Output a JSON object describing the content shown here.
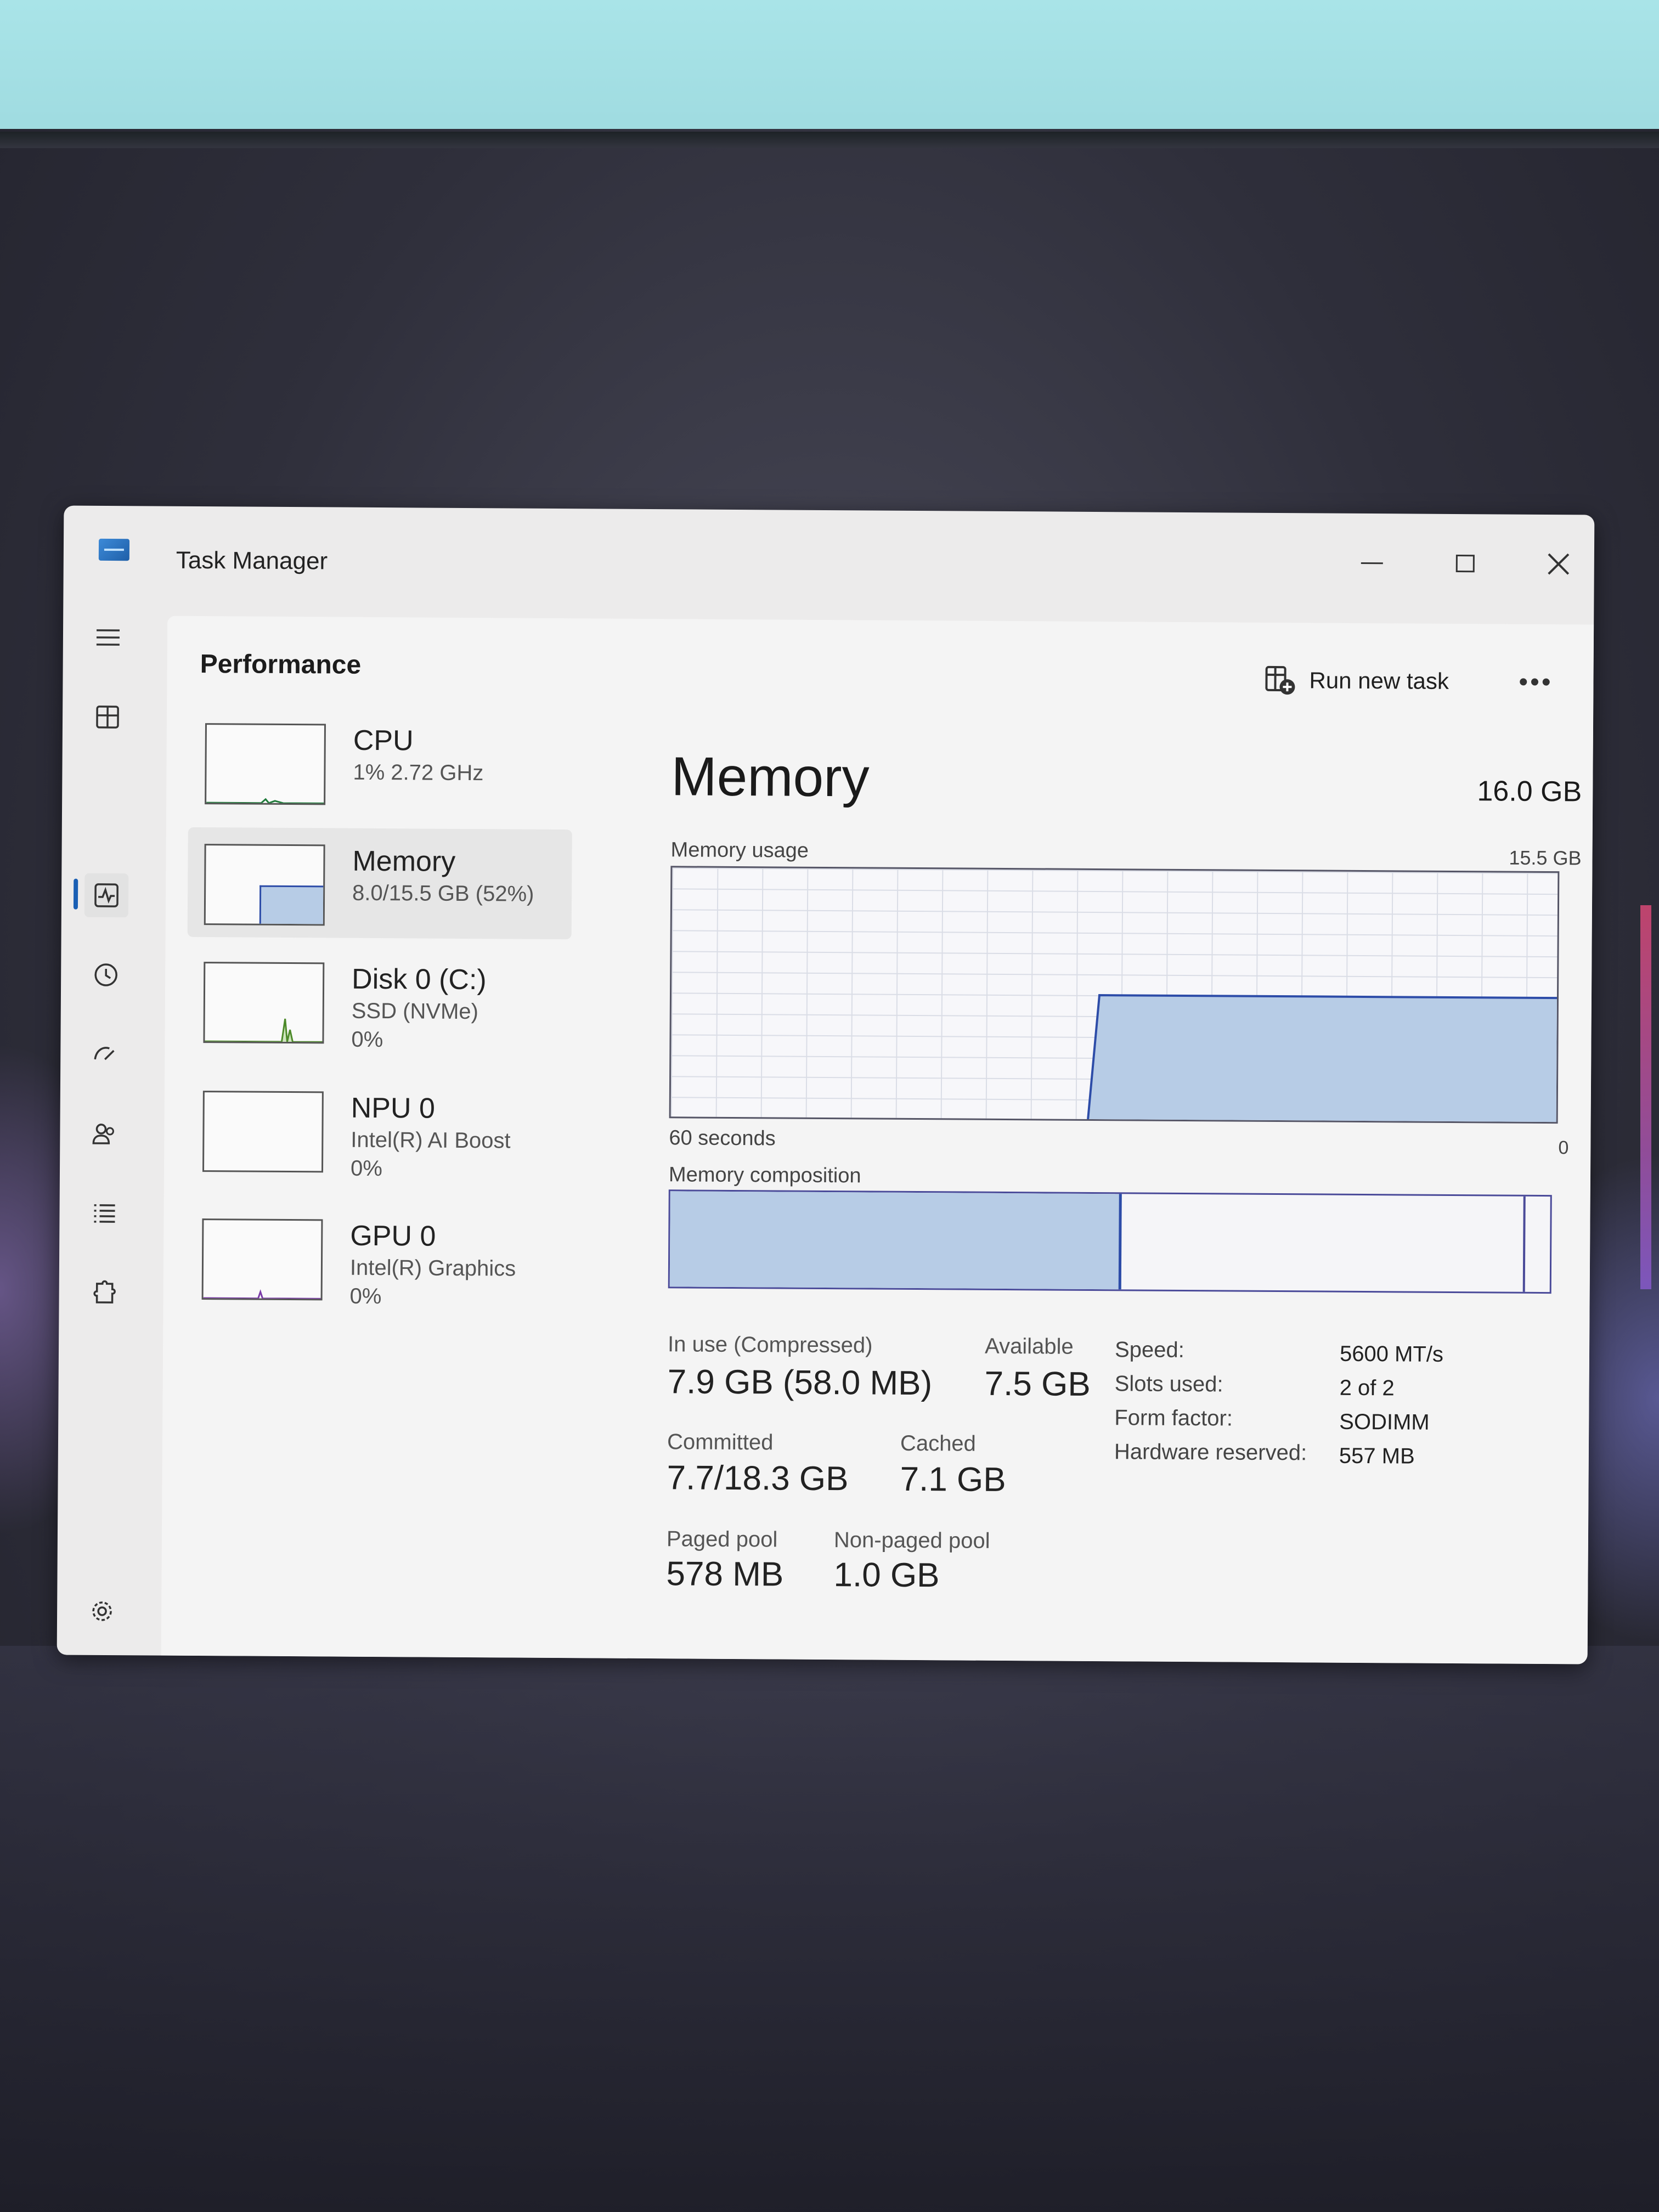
{
  "window": {
    "title": "Task Manager"
  },
  "header": {
    "title": "Performance",
    "run_new_task": "Run new task",
    "more": "•••"
  },
  "nav": {
    "items": [
      "hamburger-menu",
      "processes",
      "performance",
      "app-history",
      "startup-apps",
      "users",
      "details",
      "services",
      "settings"
    ]
  },
  "devices": [
    {
      "name": "CPU",
      "sub1": "1% 2.72 GHz",
      "sub2": ""
    },
    {
      "name": "Memory",
      "sub1": "8.0/15.5 GB (52%)",
      "sub2": ""
    },
    {
      "name": "Disk 0 (C:)",
      "sub1": "SSD (NVMe)",
      "sub2": "0%"
    },
    {
      "name": "NPU 0",
      "sub1": "Intel(R) AI Boost",
      "sub2": "0%"
    },
    {
      "name": "GPU 0",
      "sub1": "Intel(R) Graphics",
      "sub2": "0%"
    }
  ],
  "detail": {
    "title": "Memory",
    "total": "16.0 GB",
    "usage_label": "Memory usage",
    "usage_max": "15.5 GB",
    "time_label": "60 seconds",
    "zero_label": "0",
    "composition_label": "Memory composition",
    "composition_in_use_fraction": 0.51,
    "stats": {
      "in_use_label": "In use (Compressed)",
      "in_use_value": "7.9 GB (58.0 MB)",
      "available_label": "Available",
      "available_value": "7.5 GB",
      "committed_label": "Committed",
      "committed_value": "7.7/18.3 GB",
      "cached_label": "Cached",
      "cached_value": "7.1 GB",
      "paged_label": "Paged pool",
      "paged_value": "578 MB",
      "nonpaged_label": "Non-paged pool",
      "nonpaged_value": "1.0 GB"
    },
    "specs": [
      {
        "label": "Speed:",
        "value": "5600 MT/s"
      },
      {
        "label": "Slots used:",
        "value": "2 of 2"
      },
      {
        "label": "Form factor:",
        "value": "SODIMM"
      },
      {
        "label": "Hardware reserved:",
        "value": "557 MB"
      }
    ]
  },
  "colors": {
    "accent": "#1a5fb4",
    "memory_fill": "#b7cce6",
    "memory_line": "#2d4ca8",
    "graph_border": "#4a4a99"
  }
}
